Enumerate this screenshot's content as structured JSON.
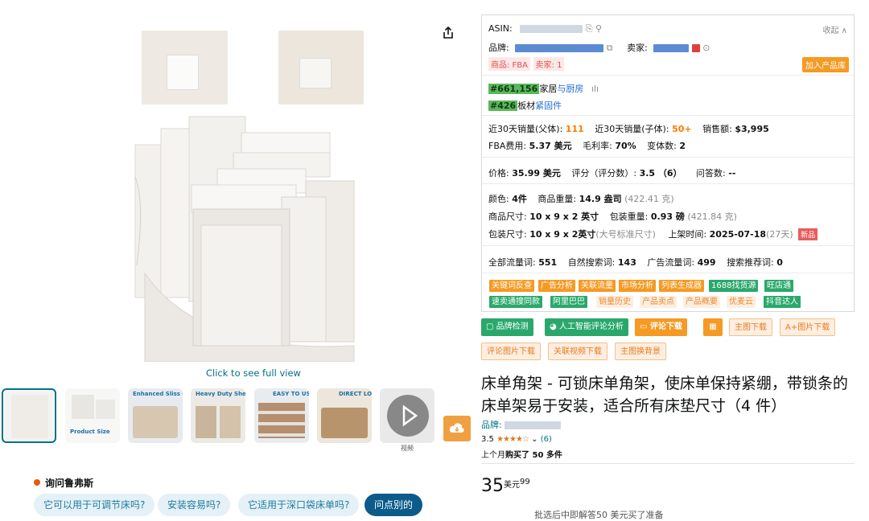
{
  "gallery": {
    "click_full": "Click to see full view",
    "thumb_tags": [
      "Product Size",
      "Enhanced Sliss Quality",
      "Heavy Duty Sheet Holders",
      "EASY TO USE",
      "DIRECT LOCK"
    ],
    "video_label": "视频"
  },
  "ask": {
    "title": "询问鲁弗斯",
    "questions": [
      "它可以用于可调节床吗?",
      "安装容易吗?",
      "它适用于深口袋床单吗?",
      "问点别的"
    ]
  },
  "panel": {
    "collapse": "收起",
    "asin_label": "ASIN:",
    "brand_label": "品牌:",
    "seller_label": "卖家:",
    "badges": [
      "商品: FBA",
      "卖家: 1"
    ],
    "add_to_library": "加入产品库",
    "rank1": {
      "rank": "#661,156",
      "cat_a": "家居",
      "cat_b": "与厨房"
    },
    "rank2": {
      "rank": "#426",
      "cat_a": "板材",
      "cat_b": "紧固件"
    },
    "sales_parent_label": "近30天销量(父体):",
    "sales_parent": "111",
    "sales_child_label": "近30天销量(子体):",
    "sales_child": "50+",
    "revenue_label": "销售额:",
    "revenue": "$3,995",
    "fba_label": "FBA费用:",
    "fba": "5.37 美元",
    "margin_label": "毛利率:",
    "margin": "70%",
    "variants_label": "变体数:",
    "variants": "2",
    "price_label": "价格:",
    "price": "35.99 美元",
    "rating_label": "评分（评分数）:",
    "rating": "3.5 （6）",
    "qa_label": "问答数:",
    "qa": "--",
    "color_label": "颜色:",
    "color": "4件",
    "weight_label": "商品重量:",
    "weight": "14.9 盎司",
    "weight_g": "(422.41 克)",
    "size_label": "商品尺寸:",
    "size": "10 x 9 x 2 英寸",
    "pkg_weight_label": "包装重量:",
    "pkg_weight": "0.93 磅",
    "pkg_weight_g": "(421.84 克)",
    "pkg_size_label": "包装尺寸:",
    "pkg_size": "10 x 9 x 2英寸",
    "pkg_size_note": "(大号标准尺寸)",
    "listed_label": "上架时间:",
    "listed": "2025-07-18",
    "listed_days": "(27天)",
    "new_badge": "新品",
    "kw_all_label": "全部流量词:",
    "kw_all": "551",
    "kw_organic_label": "自然搜索词:",
    "kw_organic": "143",
    "kw_ad_label": "广告流量词:",
    "kw_ad": "499",
    "kw_suggest_label": "搜索推荐词:",
    "kw_suggest": "0",
    "tags_row1": [
      "关键词反查",
      "广告分析",
      "关联流量",
      "市场分析",
      "列表生成器",
      "1688找货源",
      "旺店通"
    ],
    "tags_row2": [
      "速卖通搜同款",
      "阿里巴巴",
      "销量历史",
      "产品卖点",
      "产品概要",
      "优麦云",
      "抖音达人"
    ]
  },
  "actions": {
    "row1": [
      "品牌检测",
      "人工智能评论分析",
      "评论下载",
      "主图下载",
      "A+图片下载"
    ],
    "row2": [
      "评论图片下载",
      "关联视频下载",
      "主图换背景"
    ]
  },
  "product": {
    "title": "床单角架 - 可锁床单角架，使床单保持紧绷，带锁条的床单架易于安装，适合所有床垫尺寸（4 件）",
    "brand_label": "品牌:",
    "rating_value": "3.5",
    "stars": "★★★★☆",
    "rating_count": "(6)",
    "bought_prefix": "上个月",
    "bought": "购买了 50 多件",
    "price_whole": "35",
    "price_unit": "美元",
    "price_cents": "99",
    "below_text": "批选后中即解答50 美元买了准备"
  }
}
